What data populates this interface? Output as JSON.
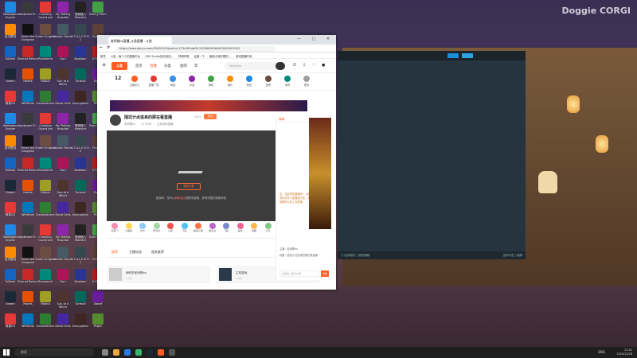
{
  "desktop": {
    "watermark": "Doggie CORGI",
    "icons": [
      {
        "label": "Wallpaper Engine",
        "color": "#1e88e5"
      },
      {
        "label": "Awakened Tr...",
        "color": "#3a3a3a"
      },
      {
        "label": "Crossing Guard Joe",
        "color": "#e53935"
      },
      {
        "label": "My Talking Hospital",
        "color": "#8e24aa"
      },
      {
        "label": "怪物猎人 Monster",
        "color": "#222"
      },
      {
        "label": "Bunny Farm",
        "color": "#43a047"
      },
      {
        "label": "拾光壁纸",
        "color": "#fb8c00"
      },
      {
        "label": "Enter the Gungeon",
        "color": "#111"
      },
      {
        "label": "Ender Knights",
        "color": "#6d4c41"
      },
      {
        "label": "Abiotic Factor",
        "color": "#455a64"
      },
      {
        "label": "S.T.A.L.K.E.R. 2",
        "color": "#37474f"
      },
      {
        "label": "Frontier",
        "color": "#5d4037"
      },
      {
        "label": "ToDesk",
        "color": "#1565c0"
      },
      {
        "label": "Eternal Return",
        "color": "#c62828"
      },
      {
        "label": "Rainworld",
        "color": "#00897b"
      },
      {
        "label": "Gori",
        "color": "#ad1457"
      },
      {
        "label": "Kowloon",
        "color": "#283593"
      },
      {
        "label": "V Rising",
        "color": "#b71c1c"
      },
      {
        "label": "Steam",
        "color": "#1b2838"
      },
      {
        "label": "Hades",
        "color": "#e65100"
      },
      {
        "label": "Fallout",
        "color": "#9e9d24"
      },
      {
        "label": "Sun of a Witch",
        "color": "#4e342e"
      },
      {
        "label": "Turmoil",
        "color": "#00695c"
      },
      {
        "label": "Dwarf",
        "color": "#6a1b9a"
      },
      {
        "label": "网易UU",
        "color": "#e53935"
      },
      {
        "label": "Wildfrost",
        "color": "#0277bd"
      },
      {
        "label": "Gamedevers",
        "color": "#2e7d32"
      },
      {
        "label": "Dead Cells",
        "color": "#4527a0"
      },
      {
        "label": "Inscryption",
        "color": "#3e2723"
      },
      {
        "label": "Peglin",
        "color": "#558b2f"
      }
    ]
  },
  "dark_app": {
    "bottom_left": "(T)选择模式 | 模型编辑",
    "bottom_right": "选择标签 | 编辑"
  },
  "browser": {
    "tab_title": "老师刚hs直播_斗鱼直播 - 斗鱼",
    "url": "https://www.douyu.com/5500010?dyshid=173c26f-da0f1310065062b0623400001501",
    "bookmarks": [
      "新导",
      "斗鱼 - 每个人的直播平台",
      "OBS Studio如何添加...",
      "哔哩哔哩",
      "百度一下",
      "最美小妹好看的...",
      "游戏直播时间"
    ],
    "site": {
      "logo": "斗鱼",
      "nav": [
        "首页",
        "直播",
        "分类",
        "鱼吧",
        "年"
      ],
      "search_placeholder": "Yemiing",
      "categories": [
        "主播中心",
        "直播广场",
        "网游",
        "手游",
        "单机",
        "娱乐",
        "科技",
        "鱼吧",
        "体育",
        "更多"
      ],
      "date_num": "12",
      "room": {
        "title": "围坑计点进来的那在看直播",
        "id_label": "1501",
        "follow": "关注",
        "meta": [
          "老师刚hs",
          "177244",
          "主机游戏直播"
        ],
        "player_error": "错误码：您可以",
        "player_error_link": "刷新重试",
        "player_hint": "或联系客服，获得完整的观看体验",
        "retry": "重新加载"
      },
      "gifts": [
        "任意门",
        "小星星",
        "办卡",
        "荧光棒",
        "火箭",
        "飞机",
        "超级火箭",
        "魔法书",
        "飞船",
        "喜欢",
        "发糖",
        "分享"
      ],
      "content_tabs": [
        "推荐",
        "主播动态",
        "相关推荐"
      ],
      "follow_btn": "+ 关注",
      "report_btn": "举报",
      "recommend": [
        {
          "title": "师时的老师刚hs",
          "meta": "1.3万"
        },
        {
          "title": "主机游戏",
          "meta": "1.2万"
        }
      ],
      "chat": {
        "tab": "弹幕",
        "notice": "友，欢迎来到直播间！斗鱼严禁未成年人直播或打赏，请谨慎辨别以防上当受骗。",
        "lines": [
          "主播：老师刚hs",
          "标题：围坑计点进来的那在看直播"
        ],
        "input_placeholder": "这里输入聊天内容",
        "send": "发送"
      }
    }
  },
  "taskbar": {
    "search_placeholder": "搜索",
    "lang": "ENG",
    "time": "21:01",
    "date": "2025/12/28"
  }
}
